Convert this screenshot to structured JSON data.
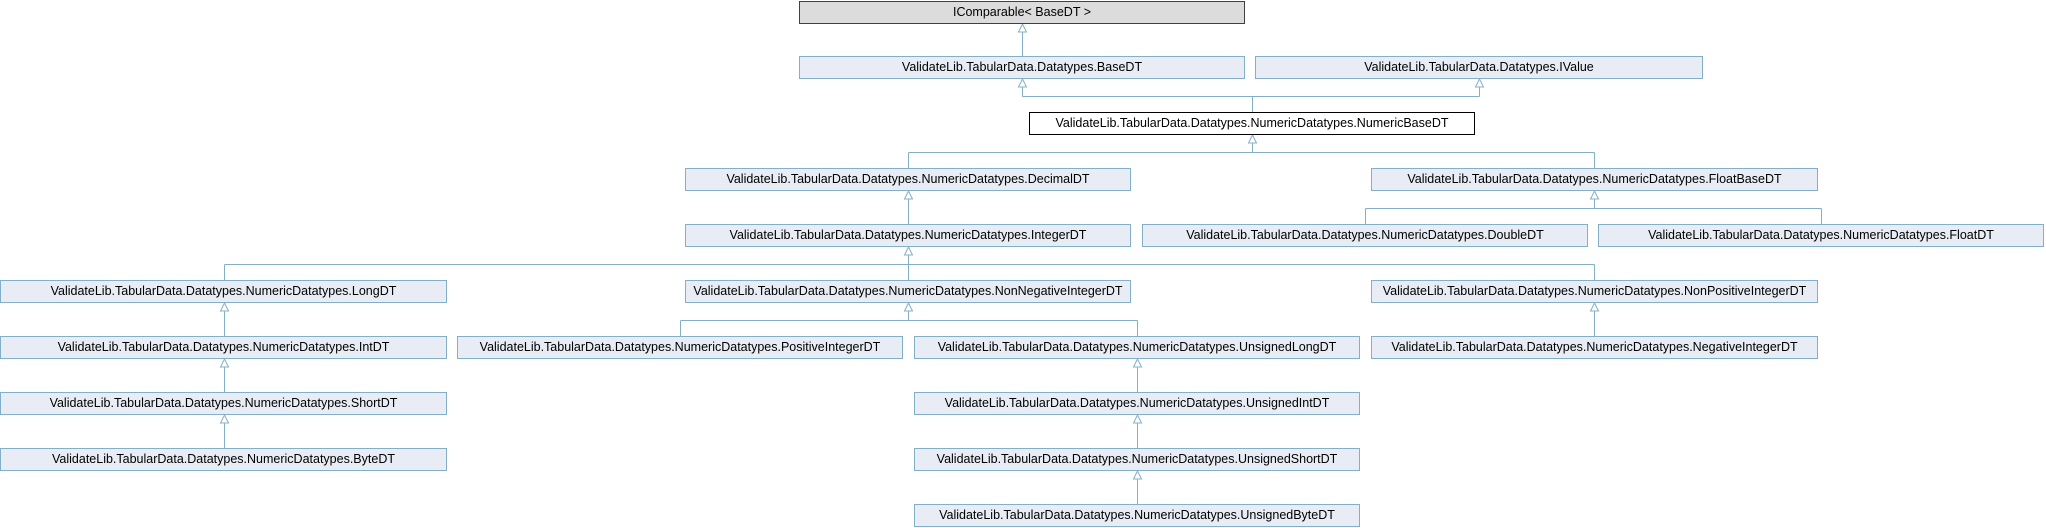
{
  "diagram": {
    "colors": {
      "edge": "#84b0c7",
      "node_fill": "#e8ecf4",
      "node_border": "#84b0c7",
      "root_fill": "#dcdcdc",
      "root_border": "#404040",
      "current_fill": "#ffffff",
      "current_border": "#000000"
    },
    "nodes": {
      "icomparable": "IComparable< BaseDT >",
      "basedt": "ValidateLib.TabularData.Datatypes.BaseDT",
      "ivalue": "ValidateLib.TabularData.Datatypes.IValue",
      "numericbasedt": "ValidateLib.TabularData.Datatypes.NumericDatatypes.NumericBaseDT",
      "decimaldt": "ValidateLib.TabularData.Datatypes.NumericDatatypes.DecimalDT",
      "floatbasedt": "ValidateLib.TabularData.Datatypes.NumericDatatypes.FloatBaseDT",
      "integerdt": "ValidateLib.TabularData.Datatypes.NumericDatatypes.IntegerDT",
      "doubledt": "ValidateLib.TabularData.Datatypes.NumericDatatypes.DoubleDT",
      "floatdt": "ValidateLib.TabularData.Datatypes.NumericDatatypes.FloatDT",
      "longdt": "ValidateLib.TabularData.Datatypes.NumericDatatypes.LongDT",
      "nonnegativeintegerdt": "ValidateLib.TabularData.Datatypes.NumericDatatypes.NonNegativeIntegerDT",
      "nonpositiveintegerdt": "ValidateLib.TabularData.Datatypes.NumericDatatypes.NonPositiveIntegerDT",
      "intdt": "ValidateLib.TabularData.Datatypes.NumericDatatypes.IntDT",
      "positiveintegerdt": "ValidateLib.TabularData.Datatypes.NumericDatatypes.PositiveIntegerDT",
      "unsignedlongdt": "ValidateLib.TabularData.Datatypes.NumericDatatypes.UnsignedLongDT",
      "negativeintegerdt": "ValidateLib.TabularData.Datatypes.NumericDatatypes.NegativeIntegerDT",
      "shortdt": "ValidateLib.TabularData.Datatypes.NumericDatatypes.ShortDT",
      "unsignedintdt": "ValidateLib.TabularData.Datatypes.NumericDatatypes.UnsignedIntDT",
      "bytedt": "ValidateLib.TabularData.Datatypes.NumericDatatypes.ByteDT",
      "unsignedshortdt": "ValidateLib.TabularData.Datatypes.NumericDatatypes.UnsignedShortDT",
      "unsignedbytedt": "ValidateLib.TabularData.Datatypes.NumericDatatypes.UnsignedByteDT"
    }
  }
}
